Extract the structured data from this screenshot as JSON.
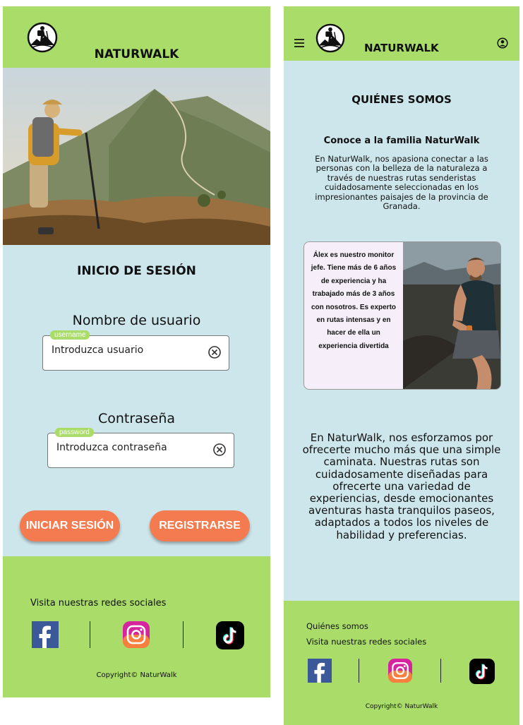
{
  "login_screen": {
    "brand": "NATURWALK",
    "title": "INICIO DE SESIÓN",
    "username": {
      "label": "Nombre de usuario",
      "tag": "username",
      "placeholder": "Introduzca usuario"
    },
    "password": {
      "label": "Contraseña",
      "tag": "password",
      "placeholder": "Introduzca contraseña"
    },
    "login_button": "INICIAR SESIÓN",
    "register_button": "REGISTRARSE",
    "footer": {
      "social_text": "Visita nuestras redes sociales",
      "copyright": "Copyright© NaturWalk"
    }
  },
  "about_screen": {
    "brand": "NATURWALK",
    "heading": "QUIÉNES SOMOS",
    "subheading": "Conoce a la familia NaturWalk",
    "intro": "En NaturWalk, nos apasiona conectar a las personas con la belleza de la naturaleza a través de nuestras rutas senderistas cuidadosamente seleccionadas en los impresionantes paisajes de la provincia de Granada.",
    "card_text": "Álex es nuestro monitor jefe. Tiene más de 6 años de experiencia y ha trabajado más de 3 años con nosotros. Es experto en rutas intensas y en hacer de ella un experiencia divertida",
    "body": "En NaturWalk, nos esforzamos por ofrecerte mucho más que una simple caminata. Nuestras rutas son cuidadosamente diseñadas para ofrecerte una variedad de experiencias, desde emocionantes aventuras hasta tranquilos paseos, adaptados a todos los niveles de habilidad y preferencias.",
    "footer": {
      "link": "Quiénes somos",
      "social_text": "Visita nuestras redes sociales",
      "copyright": "Copyright© NaturWalk"
    }
  },
  "colors": {
    "header_green": "#a9dc68",
    "page_blue": "#cde6ec",
    "button_orange": "#f47b4f"
  },
  "icons": [
    "hiker-logo",
    "menu-icon",
    "user-icon",
    "clear-icon",
    "facebook-icon",
    "instagram-icon",
    "tiktok-icon"
  ]
}
